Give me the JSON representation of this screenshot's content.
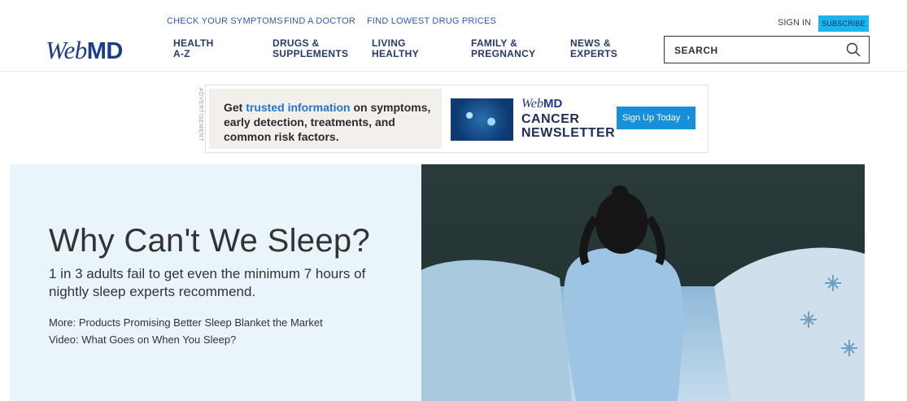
{
  "header": {
    "logo": {
      "web": "Web",
      "md": "MD"
    },
    "top_links": [
      "CHECK YOUR SYMPTOMS",
      "FIND A DOCTOR",
      "FIND LOWEST DRUG PRICES"
    ],
    "nav": [
      {
        "line1": "HEALTH",
        "line2": "A-Z"
      },
      {
        "line1": "DRUGS &",
        "line2": "SUPPLEMENTS"
      },
      {
        "line1": "LIVING",
        "line2": "HEALTHY"
      },
      {
        "line1": "FAMILY &",
        "line2": "PREGNANCY"
      },
      {
        "line1": "NEWS &",
        "line2": "EXPERTS"
      }
    ],
    "sign_in": "SIGN IN",
    "subscribe": "SUBSCRIBE",
    "search_placeholder": "SEARCH",
    "icons": {
      "search": "search-icon"
    }
  },
  "ad": {
    "label": "ADVERTISEMENT",
    "text_pre": "Get ",
    "text_highlight": "trusted information",
    "text_post": " on symptoms, early detection, treatments, and common risk factors.",
    "logo_web": "Web",
    "logo_md": "MD",
    "headline_line1": "CANCER",
    "headline_line2": "NEWSLETTER",
    "cta": "Sign Up Today",
    "cta_icon": "chevron-right-icon"
  },
  "hero": {
    "title": "Why Can't We Sleep?",
    "subtitle": "1 in 3 adults fail to get even the minimum 7 hours of nightly sleep experts recommend.",
    "links": [
      "More: Products Promising Better Sleep Blanket the Market",
      "Video: What Goes on When You Sleep?"
    ]
  },
  "colors": {
    "brand_blue": "#1c3b8c",
    "link_blue": "#2a5db0",
    "subscribe_bg": "#1eb4ed",
    "hero_bg": "#e9f5fa",
    "cta_bg": "#1a8fd9"
  }
}
